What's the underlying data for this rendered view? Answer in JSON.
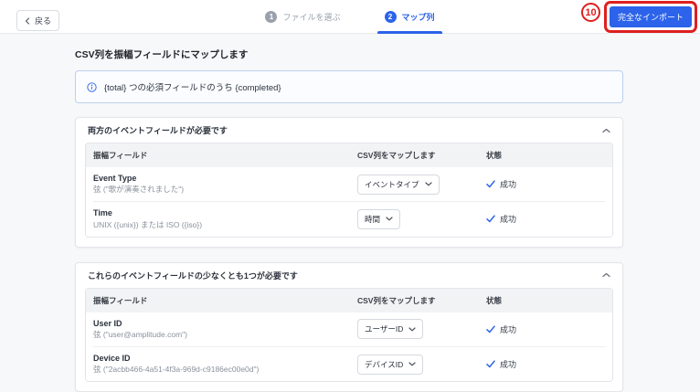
{
  "topbar": {
    "back_label": "戻る",
    "steps": [
      {
        "number": "1",
        "label": "ファイルを選ぶ"
      },
      {
        "number": "2",
        "label": "マップ列"
      }
    ],
    "import_button_label": "完全なインポート",
    "annotation_number": "10"
  },
  "page": {
    "title": "CSV列を振幅フィールドにマップします",
    "banner_text": "{total} つの必須フィールドのうち {completed}"
  },
  "table": {
    "columns": {
      "field": "振幅フィールド",
      "csv": "CSV列をマップします",
      "status": "状態"
    }
  },
  "sections": [
    {
      "title": "両方のイベントフィールドが必要です",
      "rows": [
        {
          "name": "Event Type",
          "desc": "弦 (\"歌が演奏されました\")",
          "selected": "イベントタイプ",
          "status": "成功"
        },
        {
          "name": "Time",
          "desc": "UNIX ({unix}) または ISO ({iso})",
          "selected": "時間",
          "status": "成功"
        }
      ]
    },
    {
      "title": "これらのイベントフィールドの少なくとも1つが必要です",
      "rows": [
        {
          "name": "User ID",
          "desc": "弦 (\"user@amplitude.com\")",
          "selected": "ユーザーID",
          "status": "成功"
        },
        {
          "name": "Device ID",
          "desc": "弦 (\"2acbb466-4a51-4f3a-969d-c9186ec00e0d\")",
          "selected": "デバイスID",
          "status": "成功"
        }
      ]
    }
  ],
  "colors": {
    "accent_blue": "#2c63ea",
    "annotation_red": "#df1f1f",
    "page_background": "#f7f8f9",
    "table_header_background": "#f2f3f5"
  }
}
